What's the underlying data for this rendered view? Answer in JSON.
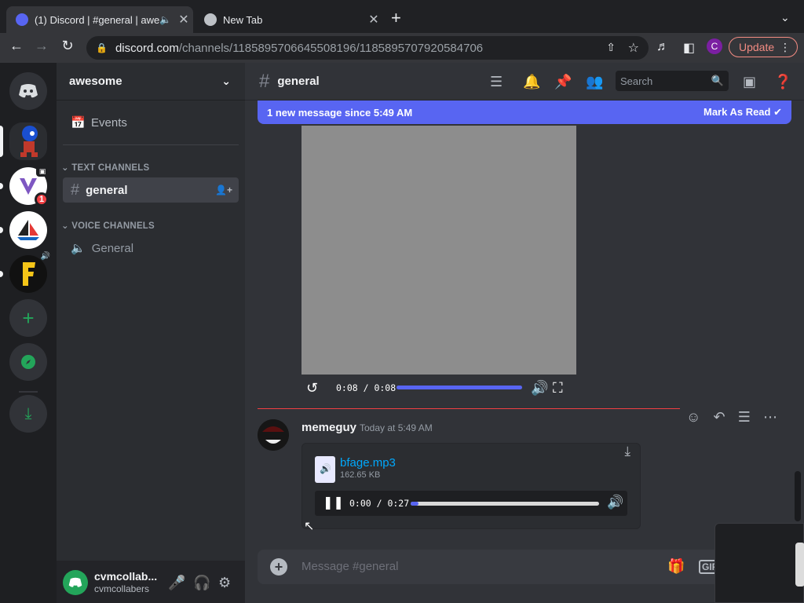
{
  "browser": {
    "tabs": [
      {
        "title": "(1) Discord | #general | awe",
        "active": true
      },
      {
        "title": "New Tab",
        "active": false
      }
    ],
    "url_host": "discord.com",
    "url_path": "/channels/1185895706645508196/1185895707920584706",
    "profile_initial": "C",
    "update_label": "Update"
  },
  "server": {
    "name": "awesome",
    "events_label": "Events",
    "text_category": "TEXT CHANNELS",
    "voice_category": "VOICE CHANNELS",
    "text_channel": "general",
    "voice_channel": "General",
    "unread_badge": "1"
  },
  "user": {
    "name": "cvmcollab...",
    "status": "cvmcollabers"
  },
  "channel": {
    "name": "general",
    "search_placeholder": "Search",
    "new_message_banner": "1 new message since 5:49 AM",
    "mark_read": "Mark As Read",
    "composer_placeholder": "Message #general",
    "gif_label": "GIF"
  },
  "video": {
    "time": "0:08 / 0:08",
    "progress": 1.0
  },
  "message": {
    "author": "memeguy",
    "timestamp": "Today at 5:49 AM",
    "file_name": "bfage.mp3",
    "file_size": "162.65 KB",
    "audio_time": "0:00 / 0:27",
    "audio_progress": 0.0
  },
  "colors": {
    "accent": "#5865f2",
    "online": "#23a55a",
    "link": "#00a8fc",
    "danger": "#f23f43"
  }
}
